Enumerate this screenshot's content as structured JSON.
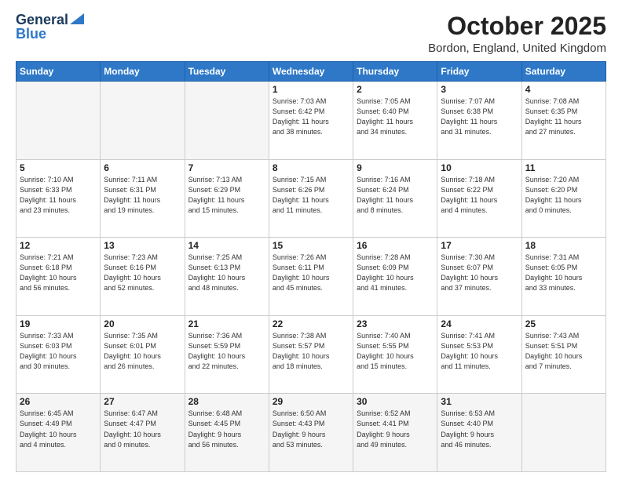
{
  "logo": {
    "line1": "General",
    "line2": "Blue"
  },
  "title": "October 2025",
  "location": "Bordon, England, United Kingdom",
  "weekdays": [
    "Sunday",
    "Monday",
    "Tuesday",
    "Wednesday",
    "Thursday",
    "Friday",
    "Saturday"
  ],
  "weeks": [
    [
      {
        "day": "",
        "info": ""
      },
      {
        "day": "",
        "info": ""
      },
      {
        "day": "",
        "info": ""
      },
      {
        "day": "1",
        "info": "Sunrise: 7:03 AM\nSunset: 6:42 PM\nDaylight: 11 hours\nand 38 minutes."
      },
      {
        "day": "2",
        "info": "Sunrise: 7:05 AM\nSunset: 6:40 PM\nDaylight: 11 hours\nand 34 minutes."
      },
      {
        "day": "3",
        "info": "Sunrise: 7:07 AM\nSunset: 6:38 PM\nDaylight: 11 hours\nand 31 minutes."
      },
      {
        "day": "4",
        "info": "Sunrise: 7:08 AM\nSunset: 6:35 PM\nDaylight: 11 hours\nand 27 minutes."
      }
    ],
    [
      {
        "day": "5",
        "info": "Sunrise: 7:10 AM\nSunset: 6:33 PM\nDaylight: 11 hours\nand 23 minutes."
      },
      {
        "day": "6",
        "info": "Sunrise: 7:11 AM\nSunset: 6:31 PM\nDaylight: 11 hours\nand 19 minutes."
      },
      {
        "day": "7",
        "info": "Sunrise: 7:13 AM\nSunset: 6:29 PM\nDaylight: 11 hours\nand 15 minutes."
      },
      {
        "day": "8",
        "info": "Sunrise: 7:15 AM\nSunset: 6:26 PM\nDaylight: 11 hours\nand 11 minutes."
      },
      {
        "day": "9",
        "info": "Sunrise: 7:16 AM\nSunset: 6:24 PM\nDaylight: 11 hours\nand 8 minutes."
      },
      {
        "day": "10",
        "info": "Sunrise: 7:18 AM\nSunset: 6:22 PM\nDaylight: 11 hours\nand 4 minutes."
      },
      {
        "day": "11",
        "info": "Sunrise: 7:20 AM\nSunset: 6:20 PM\nDaylight: 11 hours\nand 0 minutes."
      }
    ],
    [
      {
        "day": "12",
        "info": "Sunrise: 7:21 AM\nSunset: 6:18 PM\nDaylight: 10 hours\nand 56 minutes."
      },
      {
        "day": "13",
        "info": "Sunrise: 7:23 AM\nSunset: 6:16 PM\nDaylight: 10 hours\nand 52 minutes."
      },
      {
        "day": "14",
        "info": "Sunrise: 7:25 AM\nSunset: 6:13 PM\nDaylight: 10 hours\nand 48 minutes."
      },
      {
        "day": "15",
        "info": "Sunrise: 7:26 AM\nSunset: 6:11 PM\nDaylight: 10 hours\nand 45 minutes."
      },
      {
        "day": "16",
        "info": "Sunrise: 7:28 AM\nSunset: 6:09 PM\nDaylight: 10 hours\nand 41 minutes."
      },
      {
        "day": "17",
        "info": "Sunrise: 7:30 AM\nSunset: 6:07 PM\nDaylight: 10 hours\nand 37 minutes."
      },
      {
        "day": "18",
        "info": "Sunrise: 7:31 AM\nSunset: 6:05 PM\nDaylight: 10 hours\nand 33 minutes."
      }
    ],
    [
      {
        "day": "19",
        "info": "Sunrise: 7:33 AM\nSunset: 6:03 PM\nDaylight: 10 hours\nand 30 minutes."
      },
      {
        "day": "20",
        "info": "Sunrise: 7:35 AM\nSunset: 6:01 PM\nDaylight: 10 hours\nand 26 minutes."
      },
      {
        "day": "21",
        "info": "Sunrise: 7:36 AM\nSunset: 5:59 PM\nDaylight: 10 hours\nand 22 minutes."
      },
      {
        "day": "22",
        "info": "Sunrise: 7:38 AM\nSunset: 5:57 PM\nDaylight: 10 hours\nand 18 minutes."
      },
      {
        "day": "23",
        "info": "Sunrise: 7:40 AM\nSunset: 5:55 PM\nDaylight: 10 hours\nand 15 minutes."
      },
      {
        "day": "24",
        "info": "Sunrise: 7:41 AM\nSunset: 5:53 PM\nDaylight: 10 hours\nand 11 minutes."
      },
      {
        "day": "25",
        "info": "Sunrise: 7:43 AM\nSunset: 5:51 PM\nDaylight: 10 hours\nand 7 minutes."
      }
    ],
    [
      {
        "day": "26",
        "info": "Sunrise: 6:45 AM\nSunset: 4:49 PM\nDaylight: 10 hours\nand 4 minutes."
      },
      {
        "day": "27",
        "info": "Sunrise: 6:47 AM\nSunset: 4:47 PM\nDaylight: 10 hours\nand 0 minutes."
      },
      {
        "day": "28",
        "info": "Sunrise: 6:48 AM\nSunset: 4:45 PM\nDaylight: 9 hours\nand 56 minutes."
      },
      {
        "day": "29",
        "info": "Sunrise: 6:50 AM\nSunset: 4:43 PM\nDaylight: 9 hours\nand 53 minutes."
      },
      {
        "day": "30",
        "info": "Sunrise: 6:52 AM\nSunset: 4:41 PM\nDaylight: 9 hours\nand 49 minutes."
      },
      {
        "day": "31",
        "info": "Sunrise: 6:53 AM\nSunset: 4:40 PM\nDaylight: 9 hours\nand 46 minutes."
      },
      {
        "day": "",
        "info": ""
      }
    ]
  ]
}
